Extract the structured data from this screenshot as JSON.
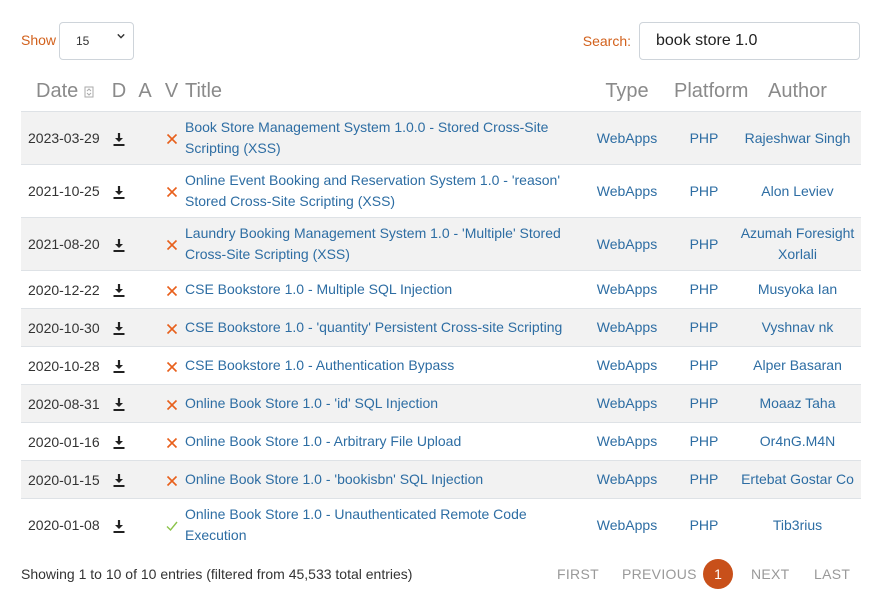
{
  "controls": {
    "show_label": "Show",
    "show_value": "15",
    "search_label": "Search:",
    "search_value": "book store 1.0"
  },
  "table": {
    "headers": {
      "date": "Date",
      "d": "D",
      "a": "A",
      "v": "V",
      "title": "Title",
      "type": "Type",
      "platform": "Platform",
      "author": "Author"
    },
    "rows": [
      {
        "date": "2023-03-29",
        "title": "Book Store Management System 1.0.0 - Stored Cross-Site Scripting (XSS)",
        "verified": false,
        "type": "WebApps",
        "platform": "PHP",
        "author": "Rajeshwar Singh"
      },
      {
        "date": "2021-10-25",
        "title": "Online Event Booking and Reservation System 1.0 - 'reason' Stored Cross-Site Scripting (XSS)",
        "verified": false,
        "type": "WebApps",
        "platform": "PHP",
        "author": "Alon Leviev"
      },
      {
        "date": "2021-08-20",
        "title": "Laundry Booking Management System 1.0 - 'Multiple' Stored Cross-Site Scripting (XSS)",
        "verified": false,
        "type": "WebApps",
        "platform": "PHP",
        "author": "Azumah Foresight Xorlali"
      },
      {
        "date": "2020-12-22",
        "title": "CSE Bookstore 1.0 - Multiple SQL Injection",
        "verified": false,
        "type": "WebApps",
        "platform": "PHP",
        "author": "Musyoka Ian"
      },
      {
        "date": "2020-10-30",
        "title": "CSE Bookstore 1.0 - 'quantity' Persistent Cross-site Scripting",
        "verified": false,
        "type": "WebApps",
        "platform": "PHP",
        "author": "Vyshnav nk"
      },
      {
        "date": "2020-10-28",
        "title": "CSE Bookstore 1.0 - Authentication Bypass",
        "verified": false,
        "type": "WebApps",
        "platform": "PHP",
        "author": "Alper Basaran"
      },
      {
        "date": "2020-08-31",
        "title": "Online Book Store 1.0 - 'id' SQL Injection",
        "verified": false,
        "type": "WebApps",
        "platform": "PHP",
        "author": "Moaaz Taha"
      },
      {
        "date": "2020-01-16",
        "title": "Online Book Store 1.0 - Arbitrary File Upload",
        "verified": false,
        "type": "WebApps",
        "platform": "PHP",
        "author": "Or4nG.M4N"
      },
      {
        "date": "2020-01-15",
        "title": "Online Book Store 1.0 - 'bookisbn' SQL Injection",
        "verified": false,
        "type": "WebApps",
        "platform": "PHP",
        "author": "Ertebat Gostar Co"
      },
      {
        "date": "2020-01-08",
        "title": "Online Book Store 1.0 - Unauthenticated Remote Code Execution",
        "verified": true,
        "type": "WebApps",
        "platform": "PHP",
        "author": "Tib3rius"
      }
    ]
  },
  "footer": {
    "info": "Showing 1 to 10 of 10 entries (filtered from 45,533 total entries)",
    "first": "FIRST",
    "previous": "PREVIOUS",
    "current_page": "1",
    "next": "NEXT",
    "last": "LAST"
  },
  "colors": {
    "accent": "#c8501a",
    "label_orange": "#d2611c",
    "link": "#2d6da3",
    "unverified": "#e8601c",
    "verified": "#8bc34a"
  },
  "icons": {
    "download": "download-icon",
    "unverified": "x-mark-icon",
    "verified": "check-mark-icon",
    "sort": "sort-icon",
    "select_chevron": "chevron-down-icon"
  }
}
